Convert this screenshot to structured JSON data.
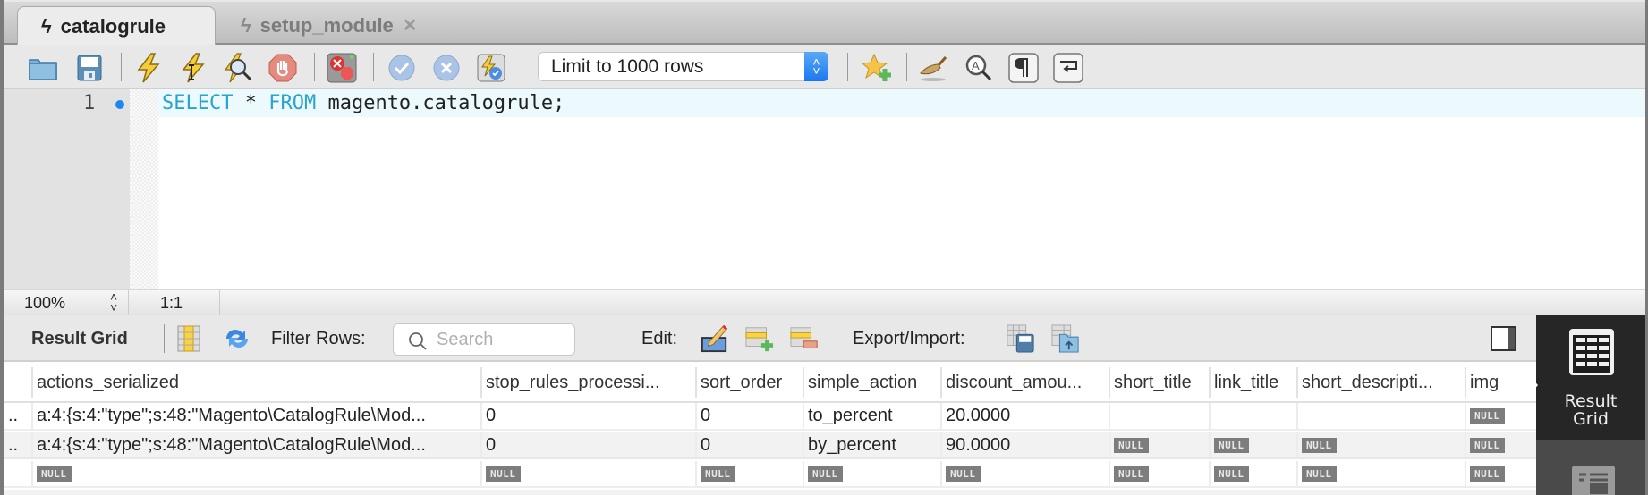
{
  "tabs": [
    {
      "label": "catalogrule",
      "icon": "lightning-icon",
      "active": true
    },
    {
      "label": "setup_module",
      "icon": "lightning-icon",
      "active": false,
      "close": "✕"
    }
  ],
  "toolbar": {
    "icons": [
      "open-folder-icon",
      "save-icon",
      "execute-icon",
      "execute-current-icon",
      "explain-icon",
      "stop-icon",
      "toggle-stop-on-error-icon",
      "commit-icon",
      "rollback-icon",
      "autocommit-icon",
      "add-snippet-icon",
      "beautify-icon",
      "find-replace-icon",
      "invisible-chars-icon",
      "wrap-lines-icon"
    ],
    "limit_select": "Limit to 1000 rows"
  },
  "editor": {
    "line_number": "1",
    "code_keyword1": "SELECT",
    "code_mid": " * ",
    "code_keyword2": "FROM",
    "code_rest": " magento.catalogrule;"
  },
  "statusbar": {
    "zoom": "100%",
    "cursor": "1:1"
  },
  "result_toolbar": {
    "title": "Result Grid",
    "filter_label": "Filter Rows:",
    "search_placeholder": "Search",
    "edit_label": "Edit:",
    "export_label": "Export/Import:"
  },
  "grid": {
    "columns": [
      "actions_serialized",
      "stop_rules_processi...",
      "sort_order",
      "simple_action",
      "discount_amou...",
      "short_title",
      "link_title",
      "short_descripti...",
      "img"
    ],
    "rows": [
      {
        "lead": "..",
        "cells": [
          "a:4:{s:4:\"type\";s:48:\"Magento\\CatalogRule\\Mod...",
          "0",
          "0",
          "to_percent",
          "20.0000",
          "",
          "",
          "",
          "NULL"
        ]
      },
      {
        "lead": "..",
        "cells": [
          "a:4:{s:4:\"type\";s:48:\"Magento\\CatalogRule\\Mod...",
          "0",
          "0",
          "by_percent",
          "90.0000",
          "NULL",
          "NULL",
          "NULL",
          "NULL"
        ]
      },
      {
        "lead": "",
        "cells": [
          "NULL",
          "NULL",
          "NULL",
          "NULL",
          "NULL",
          "NULL",
          "NULL",
          "NULL",
          "NULL"
        ]
      }
    ]
  },
  "side_panel": {
    "active_label_line1": "Result",
    "active_label_line2": "Grid"
  }
}
